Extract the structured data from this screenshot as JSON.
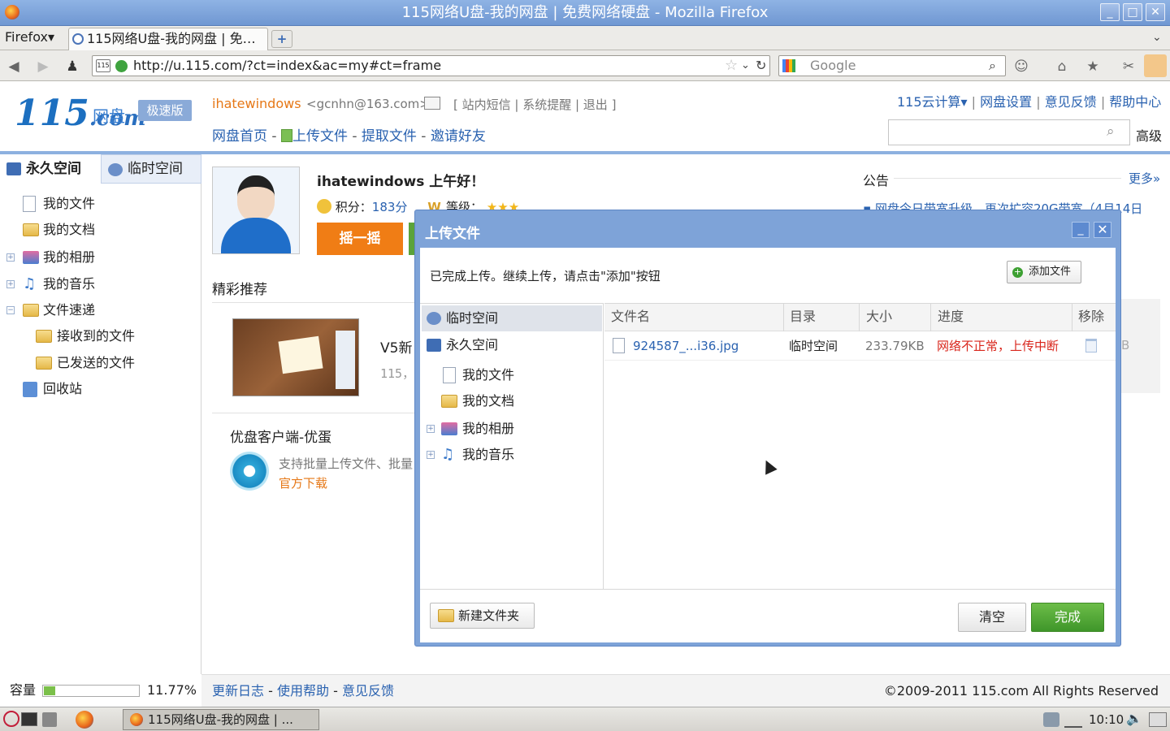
{
  "window": {
    "title": "115网络U盘-我的网盘 | 免费网络硬盘 - Mozilla Firefox"
  },
  "browser": {
    "menu_label": "Firefox",
    "tab_title": "115网络U盘-我的网盘 | 免…",
    "url": "http://u.115.com/?ct=index&ac=my#ct=frame",
    "search_placeholder": "Google"
  },
  "site": {
    "logo_text": "115",
    "logo_com": ".com",
    "logo_wangpan": "网盘",
    "badge": "极速版",
    "username": "ihatewindows",
    "email": "<gcnhn@163.com>",
    "top_links": "[ 站内短信 | 系统提醒 | 退出 ]",
    "nav": [
      "网盘首页",
      "上传文件",
      "提取文件",
      "邀请好友"
    ],
    "right_links": [
      "115云计算▾",
      "网盘设置",
      "意见反馈",
      "帮助中心"
    ],
    "advanced": "高级"
  },
  "sidebar": {
    "tab_permanent": "永久空间",
    "tab_temporary": "临时空间",
    "items": [
      {
        "label": "我的文件"
      },
      {
        "label": "我的文档"
      },
      {
        "label": "我的相册"
      },
      {
        "label": "我的音乐"
      },
      {
        "label": "文件速递"
      },
      {
        "label": "接收到的文件"
      },
      {
        "label": "已发送的文件"
      },
      {
        "label": "回收站"
      }
    ],
    "capacity_label": "容量",
    "capacity_percent": "11.77%",
    "capacity_fraction": 0.1177
  },
  "main": {
    "greeting": "ihatewindows 上午好！",
    "score_label": "积分：",
    "score_value": "183分",
    "level_label": "等级：",
    "level_stars": 3,
    "shake_button": "摇一摇",
    "recommend_title": "精彩推荐",
    "v5_title": "V5新",
    "v5_sub": "115，",
    "youpan_title": "优盘客户端-优蛋",
    "youpan_desc": "支持批量上传文件、批量",
    "youpan_download": "官方下载",
    "notice_title": "公告",
    "notice_more": "更多»",
    "notice_item": "网盘今日带宽升级，再次扩容20G带宽（4月14日"
  },
  "footer": {
    "links": [
      "更新日志",
      "使用帮助",
      "意见反馈"
    ],
    "copyright": "©2009-2011 115.com All Rights Reserved"
  },
  "taskbar": {
    "task_title": "115网络U盘-我的网盘 | ...",
    "clock": "10:10"
  },
  "dialog": {
    "title": "上传文件",
    "status": "已完成上传。继续上传，请点击\"添加\"按钮",
    "add_file": "添加文件",
    "dirs": [
      {
        "label": "临时空间"
      },
      {
        "label": "永久空间"
      },
      {
        "label": "我的文件"
      },
      {
        "label": "我的文档"
      },
      {
        "label": "我的相册"
      },
      {
        "label": "我的音乐"
      }
    ],
    "columns": [
      "文件名",
      "目录",
      "大小",
      "进度",
      "移除"
    ],
    "files": [
      {
        "name": "924587_...i36.jpg",
        "dir": "临时空间",
        "size": "233.79KB",
        "progress": "网络不正常，上传中断"
      }
    ],
    "new_folder": "新建文件夹",
    "clear": "清空",
    "done": "完成"
  },
  "colors": {
    "accent_blue": "#2a62b0",
    "orange": "#e67817",
    "error_red": "#d9261c",
    "done_green": "#4aa233"
  }
}
